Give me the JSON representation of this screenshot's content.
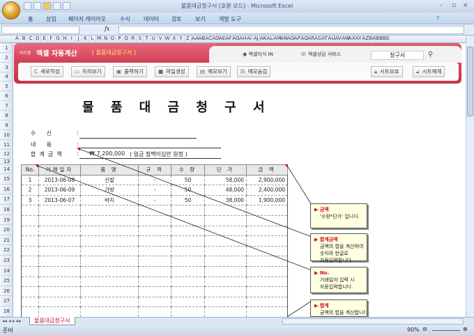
{
  "window": {
    "title": "물품대금청구서  [호환 모드] - Microsoft Excel"
  },
  "ribbon_tabs": [
    "홈",
    "삽입",
    "페이지 레이아웃",
    "수식",
    "데이터",
    "검토",
    "보기",
    "개발 도구"
  ],
  "formula_bar": {
    "fx": "fx"
  },
  "columns": [
    "A",
    "B",
    "C",
    "D",
    "E",
    "F",
    "G",
    "H",
    "I",
    "J",
    "K",
    "L",
    "M",
    "N",
    "O",
    "P",
    "Q",
    "R",
    "S",
    "T",
    "U",
    "V",
    "W",
    "X",
    "Y",
    "Z",
    "AA",
    "AB",
    "AC",
    "AD",
    "AE",
    "AF",
    "AG",
    "AH",
    "AI",
    "AJ",
    "AK",
    "AL",
    "AM",
    "AN",
    "AO",
    "AP",
    "AQ",
    "AR",
    "AS",
    "AT",
    "AU",
    "AV",
    "AW",
    "AX",
    "AY",
    "AZ",
    "BA",
    "BB",
    "BE"
  ],
  "banner": {
    "brand_small": "비즈폼",
    "brand": "엑셀 자동계산",
    "doc": "[ 물품대금청구서 ]",
    "tab1": "엑셀지식 IN",
    "tab2": "엑셀상담 서비스",
    "search_value": "청구서",
    "buttons": [
      "새로작성",
      "미리보기",
      "출력하기",
      "파일생성",
      "메모보기",
      "메모숨김"
    ],
    "protect": "시트보호",
    "unprotect": "시트해제"
  },
  "doc": {
    "title": "물 품 대 금 청 구 서",
    "to_label": "수      신",
    "content_label": "내      용",
    "total_label": "합  계  금  액",
    "colon": ":",
    "total_value": "₩ 7,200,000",
    "total_korean": "( 일금 칠백이십만 원정 )"
  },
  "table": {
    "headers": [
      "No.",
      "거래일자",
      "품  명",
      "규  격",
      "수  량",
      "단  가",
      "금  액"
    ],
    "rows": [
      [
        "1",
        "2013-06-08",
        "신발",
        "-",
        "50",
        "58,000",
        "2,900,000"
      ],
      [
        "2",
        "2013-06-09",
        "가방",
        "-",
        "50",
        "48,000",
        "2,400,000"
      ],
      [
        "3",
        "2013-06-07",
        "바지",
        "-",
        "50",
        "38,000",
        "1,900,000"
      ]
    ]
  },
  "notes": [
    {
      "title": "▶ 금액",
      "body": "'수량*단가' 입니다."
    },
    {
      "title": "▶ 합계금액",
      "body": "금액의 합을 계산하여\n숫자와 한글로\n자동입력합니다."
    },
    {
      "title": "▶ No.",
      "body": "거래일자 입력 시\n자동입력합니다."
    },
    {
      "title": "▶ 합계",
      "body": "금액의 합을 계산합니다."
    }
  ],
  "sheet_tab": "물품대금청구서",
  "status": {
    "left": "준비",
    "zoom": "90%"
  }
}
